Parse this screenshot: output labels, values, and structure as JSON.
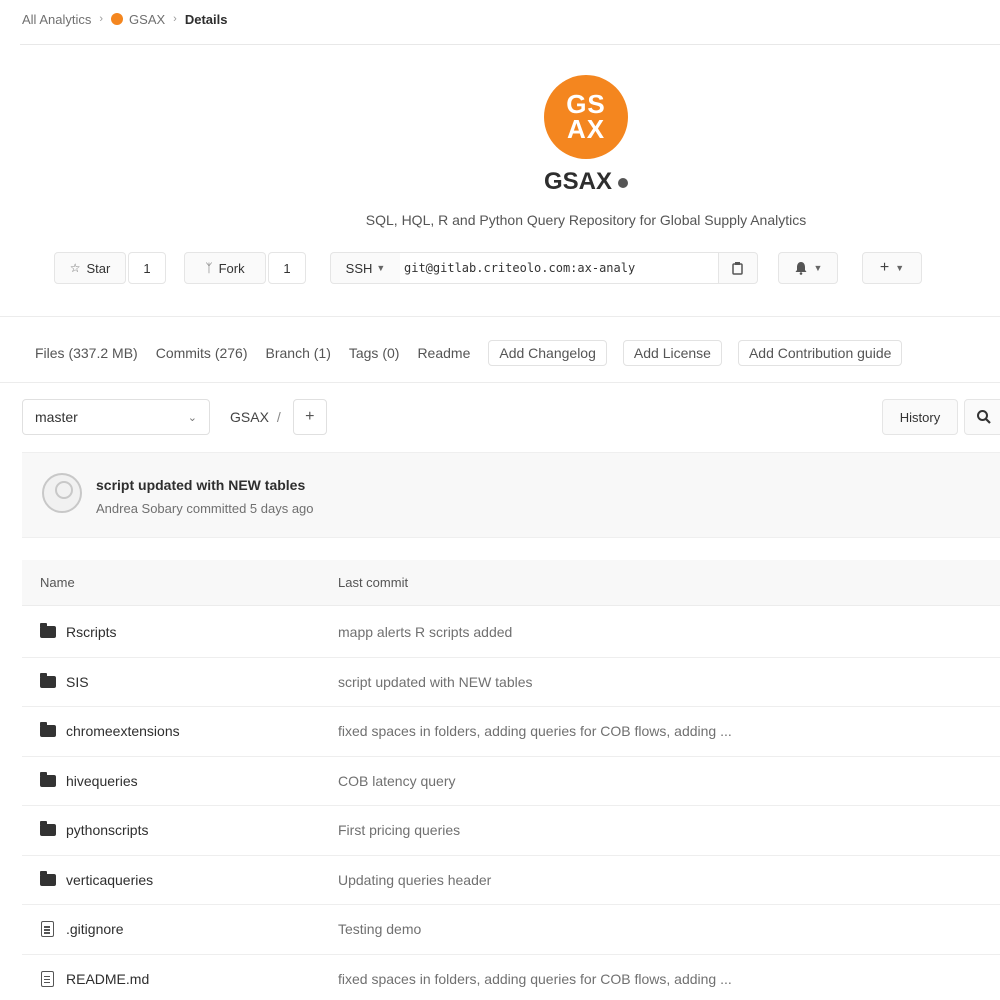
{
  "breadcrumb": {
    "group": "All Analytics",
    "project": "GSAX",
    "current": "Details"
  },
  "project": {
    "avatar_line1": "GS",
    "avatar_line2": "AX",
    "name": "GSAX",
    "description": "SQL, HQL, R and Python Query Repository for Global Supply Analytics",
    "avatar_color": "#f4861f"
  },
  "actions": {
    "star_label": "Star",
    "star_count": "1",
    "fork_label": "Fork",
    "fork_count": "1",
    "protocol": "SSH",
    "clone_url": "git@gitlab.criteolo.com:ax-analy",
    "copy_icon": "clipboard-icon",
    "notification_icon": "bell-icon",
    "add_icon": "plus-icon"
  },
  "stats": {
    "files": "Files (337.2 MB)",
    "commits": "Commits (276)",
    "branch": "Branch (1)",
    "tags": "Tags (0)",
    "readme": "Readme",
    "add_changelog": "Add Changelog",
    "add_license": "Add License",
    "add_contribution": "Add Contribution guide"
  },
  "tree": {
    "branch": "master",
    "path_root": "GSAX",
    "path_sep": "/",
    "plus": "+",
    "history_label": "History"
  },
  "last_commit": {
    "title": "script updated with NEW tables",
    "meta": "Andrea Sobary committed 5 days ago"
  },
  "table": {
    "col_name": "Name",
    "col_last_commit": "Last commit",
    "rows": [
      {
        "name": "Rscripts",
        "type": "folder",
        "message": "mapp alerts R scripts added"
      },
      {
        "name": "SIS",
        "type": "folder",
        "message": "script updated with NEW tables"
      },
      {
        "name": "chromeextensions",
        "type": "folder",
        "message": "fixed spaces in folders, adding queries for COB flows, adding ..."
      },
      {
        "name": "hivequeries",
        "type": "folder",
        "message": "COB latency query"
      },
      {
        "name": "pythonscripts",
        "type": "folder",
        "message": "First pricing queries"
      },
      {
        "name": "verticaqueries",
        "type": "folder",
        "message": "Updating queries header"
      },
      {
        "name": ".gitignore",
        "type": "file",
        "message": "Testing demo"
      },
      {
        "name": "README.md",
        "type": "file",
        "message": "fixed spaces in folders, adding queries for COB flows, adding ..."
      }
    ]
  }
}
